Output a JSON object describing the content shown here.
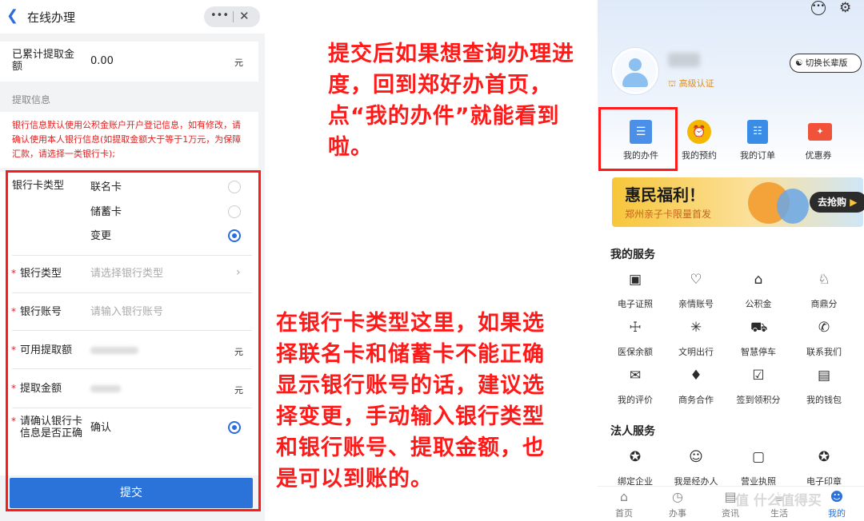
{
  "left": {
    "title": "在线办理",
    "accum_label": "已累计提取金额",
    "accum_value": "0.00",
    "unit": "元",
    "section_title": "提取信息",
    "notice": "银行信息默认使用公积金账户开户登记信息，如有修改，请确认使用本人银行信息(如提取金额大于等于1万元，为保障汇款，请选择一类银行卡);",
    "card_type_label": "银行卡类型",
    "card_options": [
      "联名卡",
      "储蓄卡",
      "变更"
    ],
    "bank_type_label": "银行类型",
    "bank_type_placeholder": "请选择银行类型",
    "account_label": "银行账号",
    "account_placeholder": "请输入银行账号",
    "available_label": "可用提取额",
    "amount_label": "提取金额",
    "confirm_label": "请确认银行卡信息是否正确",
    "confirm_value": "确认",
    "submit": "提交"
  },
  "annotations": {
    "top": "提交后如果想查询办理进度，回到郑好办首页，点“我的办件”就能看到啦。",
    "bottom": "在银行卡类型这里，如果选择联名卡和储蓄卡不能正确显示银行账号的话，建议选择变更，手动输入银行类型和银行账号、提取金额，也是可以到账的。"
  },
  "right": {
    "auth_badge": "高级认证",
    "switch_mode": "切换长辈版",
    "quick": [
      "我的办件",
      "我的预约",
      "我的订单",
      "优惠券"
    ],
    "banner_title": "惠民福利！",
    "banner_sub": "郑州亲子卡限量首发",
    "banner_btn": "去抢购",
    "my_services_title": "我的服务",
    "services": [
      "电子证照",
      "亲情账号",
      "公积金",
      "商鼎分",
      "医保余额",
      "文明出行",
      "智慧停车",
      "联系我们",
      "我的评价",
      "商务合作",
      "签到领积分",
      "我的钱包"
    ],
    "legal_title": "法人服务",
    "legal": [
      "绑定企业",
      "我是经办人",
      "营业执照",
      "电子印章"
    ],
    "tabs": [
      "首页",
      "办事",
      "资讯",
      "生活",
      "我的"
    ],
    "watermark": "值 什么值得买"
  },
  "colors": {
    "accent_red": "#ff1a1a",
    "primary_blue": "#2b72d9",
    "banner_orange": "#f39a1f"
  }
}
